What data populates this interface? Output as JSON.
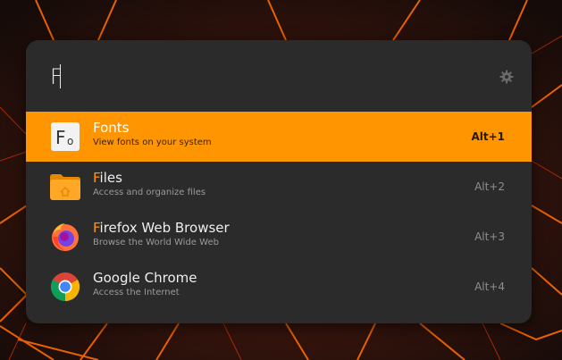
{
  "search": {
    "query": "F",
    "settings_icon": "gear-icon"
  },
  "results": [
    {
      "match": "",
      "rest": "Fonts",
      "description": "View fonts on your system",
      "shortcut": "Alt+1",
      "icon": "fonts-app-icon",
      "selected": true
    },
    {
      "match": "F",
      "rest": "iles",
      "description": "Access and organize files",
      "shortcut": "Alt+2",
      "icon": "files-app-icon",
      "selected": false
    },
    {
      "match": "F",
      "rest": "irefox Web Browser",
      "description": "Browse the World Wide Web",
      "shortcut": "Alt+3",
      "icon": "firefox-app-icon",
      "selected": false
    },
    {
      "match": "",
      "rest": "Google Chrome",
      "description": "Access the Internet",
      "shortcut": "Alt+4",
      "icon": "chrome-app-icon",
      "selected": false
    }
  ],
  "colors": {
    "accent": "#ff9500",
    "panel": "#2b2b2b"
  }
}
